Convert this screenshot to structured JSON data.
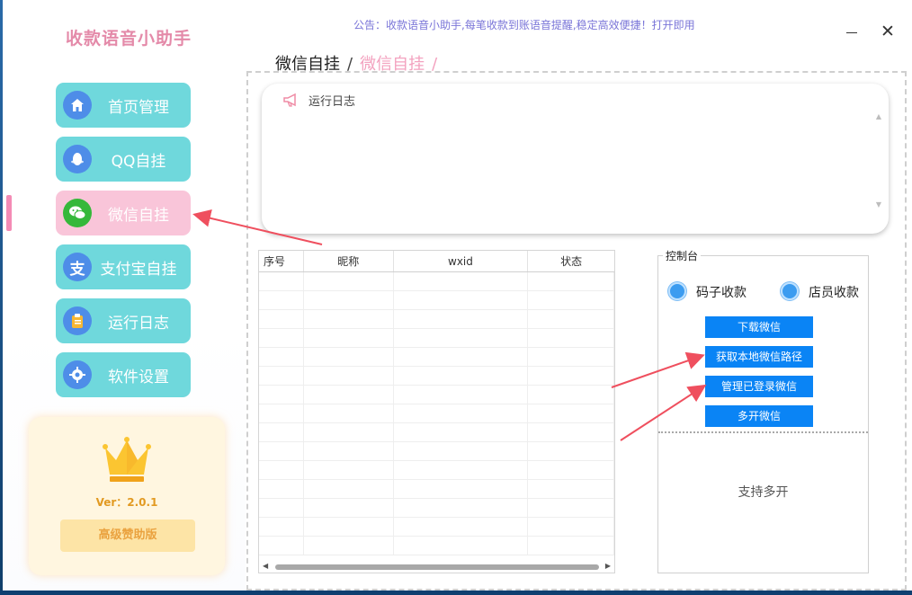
{
  "app": {
    "title": "收款语音小助手",
    "notice": "公告：收款语音小助手,每笔收款到账语音提醒,稳定高效便捷！打开即用"
  },
  "sidebar": {
    "items": [
      {
        "label": "首页管理",
        "icon": "home-icon"
      },
      {
        "label": "QQ自挂",
        "icon": "qq-icon"
      },
      {
        "label": "微信自挂",
        "icon": "wechat-icon",
        "active": true
      },
      {
        "label": "支付宝自挂",
        "icon": "alipay-icon"
      },
      {
        "label": "运行日志",
        "icon": "clipboard-icon"
      },
      {
        "label": "软件设置",
        "icon": "gear-icon"
      }
    ],
    "vip": {
      "version": "Ver：2.0.1",
      "button": "高级赞助版"
    }
  },
  "breadcrumb": {
    "parent": "微信自挂",
    "separator": "/",
    "current": "微信自挂",
    "trailing": "/"
  },
  "log": {
    "title": "运行日志"
  },
  "table": {
    "columns": [
      "序号",
      "昵称",
      "wxid",
      "状态"
    ],
    "rows": []
  },
  "control": {
    "title": "控制台",
    "radio1": "码子收款",
    "radio2": "店员收款",
    "buttons": [
      "下载微信",
      "获取本地微信路径",
      "管理已登录微信",
      "多开微信"
    ],
    "support_text": "支持多开"
  },
  "colors": {
    "nav_bg": "#6fd8dc",
    "nav_active_bg": "#f9c5d9",
    "primary_button": "#0a84f5",
    "title_pink": "#e48aa9",
    "arrow_red": "#ef4f5e"
  }
}
